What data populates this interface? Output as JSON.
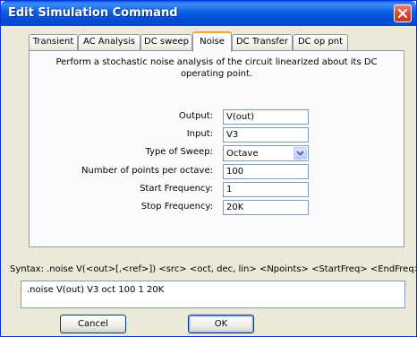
{
  "window": {
    "title": "Edit Simulation Command"
  },
  "tabs": [
    {
      "label": "Transient",
      "active": false
    },
    {
      "label": "AC Analysis",
      "active": false
    },
    {
      "label": "DC sweep",
      "active": false
    },
    {
      "label": "Noise",
      "active": true
    },
    {
      "label": "DC Transfer",
      "active": false
    },
    {
      "label": "DC op pnt",
      "active": false
    }
  ],
  "noise": {
    "description": "Perform a stochastic noise analysis of the circuit linearized about its DC operating point.",
    "output_label": "Output:",
    "output_value": "V(out)",
    "input_label": "Input:",
    "input_value": "V3",
    "sweep_label": "Type of Sweep:",
    "sweep_value": "Octave",
    "points_label": "Number of points per octave:",
    "points_value": "100",
    "start_label": "Start Frequency:",
    "start_value": "1",
    "stop_label": "Stop Frequency:",
    "stop_value": "20K"
  },
  "syntax": "Syntax: .noise V(<out>[,<ref>]) <src> <oct, dec, lin> <Npoints> <StartFreq> <EndFreq>",
  "command": ".noise V(out) V3 oct 100 1 20K",
  "buttons": {
    "cancel": "Cancel",
    "ok": "OK"
  },
  "colors": {
    "title_bar": "#0a5fe0",
    "close_button": "#d5452b",
    "active_tab_accent": "#f1a53b",
    "dialog_bg": "#ece9d8"
  }
}
